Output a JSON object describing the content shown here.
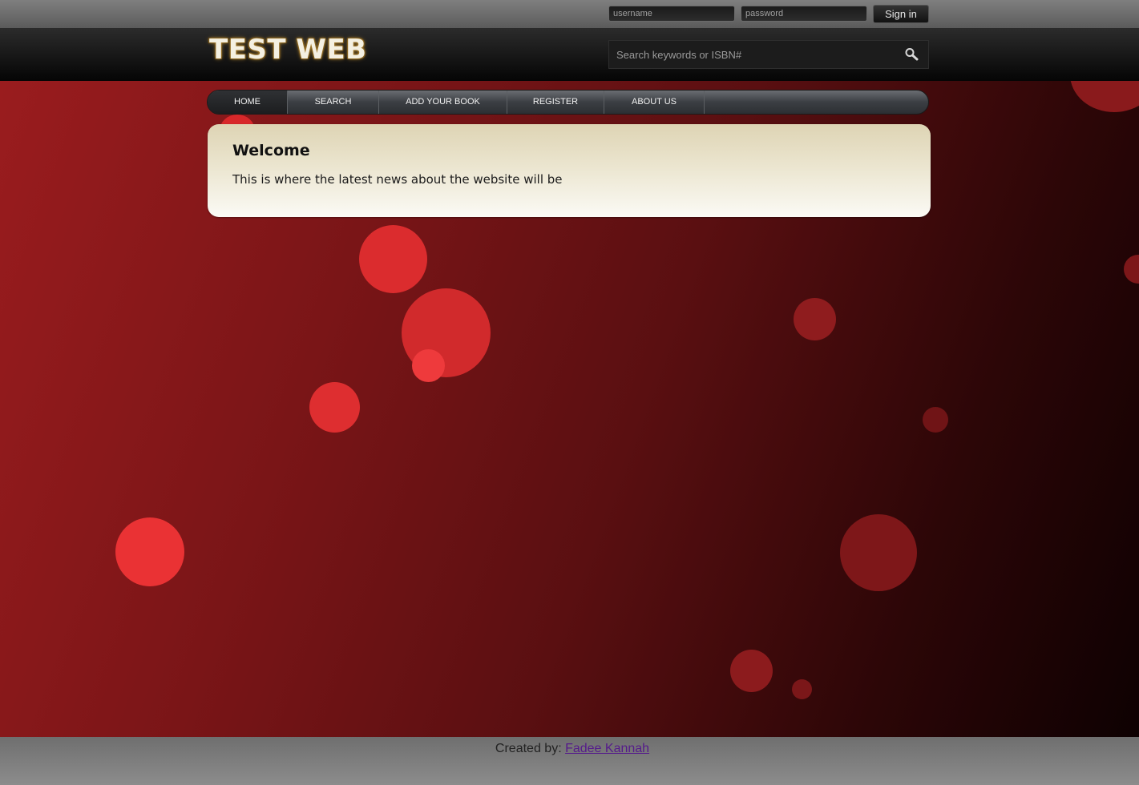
{
  "login": {
    "username_placeholder": "username",
    "password_placeholder": "password",
    "signin_label": "Sign in"
  },
  "header": {
    "logo_text": "TEST WEB",
    "search_placeholder": "Search keywords or ISBN#",
    "search_icon": "magnifier-icon"
  },
  "nav": {
    "items": [
      {
        "label": "HOME"
      },
      {
        "label": "SEARCH"
      },
      {
        "label": "ADD YOUR BOOK"
      },
      {
        "label": "REGISTER"
      },
      {
        "label": "ABOUT US"
      }
    ]
  },
  "welcome": {
    "title": "Welcome",
    "text": "This is where the latest news about the website will be"
  },
  "footer": {
    "created_by": "Created by: ",
    "author": "Fadee Kannah"
  },
  "colors": {
    "background_red": "#9a1c1e",
    "background_dark": "#0e0102",
    "bubble_red": "#e83234",
    "panel_cream": "#ded4b4",
    "link_purple": "#551a8b"
  }
}
